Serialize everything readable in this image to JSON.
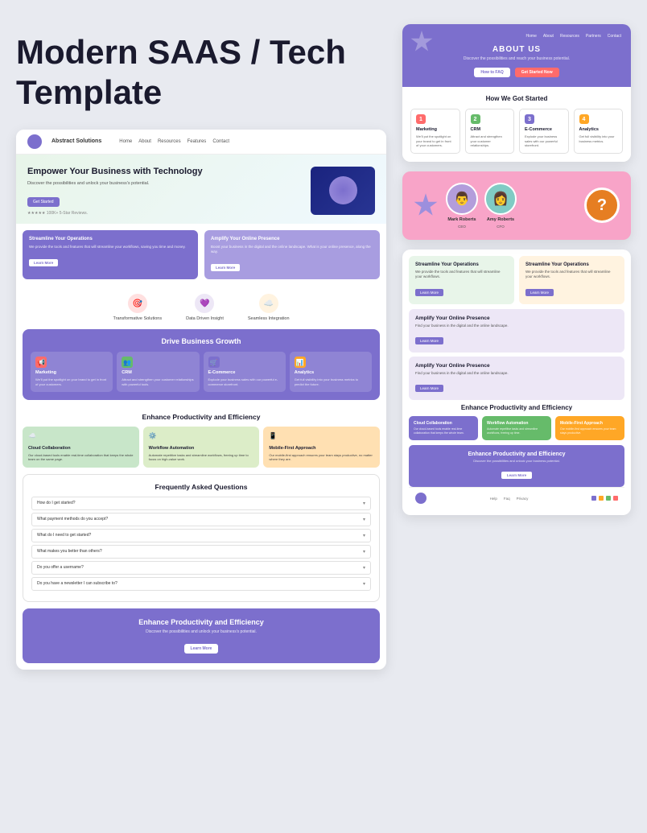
{
  "page": {
    "title": "Modern SAAS / Tech Template"
  },
  "left": {
    "title_line1": "Modern SAAS / Tech",
    "title_line2": "Template",
    "nav": {
      "brand": "Abstract Solutions",
      "links": [
        "Home",
        "About",
        "Resources",
        "Features",
        "Contact"
      ]
    },
    "hero": {
      "title": "Empower Your Business with Technology",
      "subtitle": "Discover the possibilities and unlock your business's potential.",
      "btn": "Get Started",
      "stars": "★★★★★ 100K+ 5-Star Reviews."
    },
    "cards": [
      {
        "title": "Streamline Your Operations",
        "text": "We provide the tools and features that will streamline your workflows, saving you time and money.",
        "btn": "Learn More"
      },
      {
        "title": "Amplify Your Online Presence",
        "text": "Boost your business in the digital and the online landscape. What is your online presence, along the way.",
        "btn": "Learn More"
      }
    ],
    "icons": [
      {
        "label": "Transformative Solutions",
        "emoji": "🎯",
        "bg": "#ff6b6b"
      },
      {
        "label": "Data Driven Insight",
        "emoji": "💜",
        "bg": "#e0b0ff"
      },
      {
        "label": "Seamless Integration",
        "emoji": "☁️",
        "bg": "#ff8c00"
      }
    ],
    "drive": {
      "title": "Drive Business Growth",
      "cards": [
        {
          "title": "Marketing",
          "text": "We'll put the spotlight on your brand to get in front of your customers.",
          "emoji": "📢",
          "bg": "#ff6b6b"
        },
        {
          "title": "CRM",
          "text": "Attract and strengthen your customer relationships with powerful tools.",
          "emoji": "👥",
          "bg": "#66bb6a"
        },
        {
          "title": "E-Commerce",
          "text": "Explode your business sales with our powerful e-commerce storefront.",
          "emoji": "🛒",
          "bg": "#7c6fcd"
        },
        {
          "title": "Analytics",
          "text": "Get full visibility into your business metrics to predict the future.",
          "emoji": "📊",
          "bg": "#ffa726"
        }
      ]
    },
    "enhance": {
      "title": "Enhance Productivity and Efficiency",
      "cards": [
        {
          "title": "Cloud Collaboration",
          "text": "Our cloud-based tools enable real-time collaboration that keeps the whole team on the same page.",
          "emoji": "☁️",
          "bg": "#4caf50",
          "card_bg": "green"
        },
        {
          "title": "Workflow Automation",
          "text": "Automate repetitive tasks and streamline workflows, freeing up time to focus on high-value work.",
          "emoji": "⚙️",
          "bg": "#66bb6a",
          "card_bg": "yellow-green"
        },
        {
          "title": "Mobile-First Approach",
          "text": "Our mobile-first approach ensures your team stays productive, no matter where they are.",
          "emoji": "📱",
          "bg": "#ffa726",
          "card_bg": "orange"
        }
      ]
    },
    "faq": {
      "title": "Frequently Asked Questions",
      "items": [
        "How do I get started?",
        "What payment methods do you accept?",
        "What do I need to get started?",
        "What makes you better than others?",
        "Do you offer a username?",
        "Do you have a newsletter I can subscribe to?"
      ]
    },
    "bottom_enhance": {
      "title": "Enhance Productivity and Efficiency",
      "subtitle": "Discover the possibilities and unlock your business's potential.",
      "btn": "Learn More"
    }
  },
  "right": {
    "about": {
      "nav": [
        "Home",
        "About",
        "Resources",
        "Partners",
        "Contact"
      ],
      "title": "ABOUT US",
      "subtitle": "Discover the possibilities and reach your business potential.",
      "btn1": "How to FAQ",
      "btn2": "Get Started Now"
    },
    "how": {
      "title": "How We Got Started",
      "cards": [
        {
          "num": "1",
          "title": "Marketing",
          "text": "We'll put the spotlight on your brand to get in front of your customers.",
          "color": "#ff6b6b"
        },
        {
          "num": "2",
          "title": "CRM",
          "text": "Attract and strengthen your customer relationships.",
          "color": "#66bb6a"
        },
        {
          "num": "3",
          "title": "E-Commerce",
          "text": "Explode your business sales with our powerful storefront.",
          "color": "#7c6fcd"
        },
        {
          "num": "4",
          "title": "Analytics",
          "text": "Get full visibility into your business metrics.",
          "color": "#ffa726"
        }
      ]
    },
    "mid": {
      "avatars": [
        {
          "name": "Mark Roberts",
          "role": "CEO",
          "emoji": "👨"
        },
        {
          "name": "Amy Roberts",
          "role": "CFO",
          "emoji": "👩"
        }
      ]
    },
    "bot": {
      "top_cards": [
        {
          "title": "Streamline Your Operations",
          "text": "We provide the tools and features that will streamline your workflows.",
          "btn": "Learn More",
          "style": "light-green"
        },
        {
          "title": "Streamline Your Operations",
          "text": "We provide the tools and features that will streamline your workflows.",
          "btn": "Learn More",
          "style": "orange-light"
        }
      ],
      "full_cards": [
        {
          "title": "Amplify Your Online Presence",
          "text": "Find your business in the digital and the online landscape.",
          "btn": "Learn More"
        },
        {
          "title": "Amplify Your Online Presence",
          "text": "Find your business in the digital and the online landscape.",
          "btn": "Learn More"
        }
      ],
      "enhance_title": "Enhance Productivity and Efficiency",
      "sm_cards": [
        {
          "title": "Cloud Collaboration",
          "text": "Our cloud-based tools enable real-time collaboration that keeps the whole team.",
          "style": "purple2"
        },
        {
          "title": "Workflow Automation",
          "text": "Automate repetitive tasks and streamline workflows, freeing up time.",
          "style": "green2"
        },
        {
          "title": "Mobile-First Approach",
          "text": "Our mobile-first approach ensures your team stays productive.",
          "style": "orange2"
        }
      ],
      "bottom_bar": {
        "title": "Enhance Productivity and Efficiency",
        "subtitle": "Discover the possibilities and unlock your business potential.",
        "btn": "Learn More"
      },
      "footer": {
        "links": [
          "Help",
          "Faq",
          "Privacy"
        ],
        "dot_colors": [
          "#7c6fcd",
          "#ffa726",
          "#66bb6a",
          "#ff6b6b"
        ]
      }
    }
  }
}
